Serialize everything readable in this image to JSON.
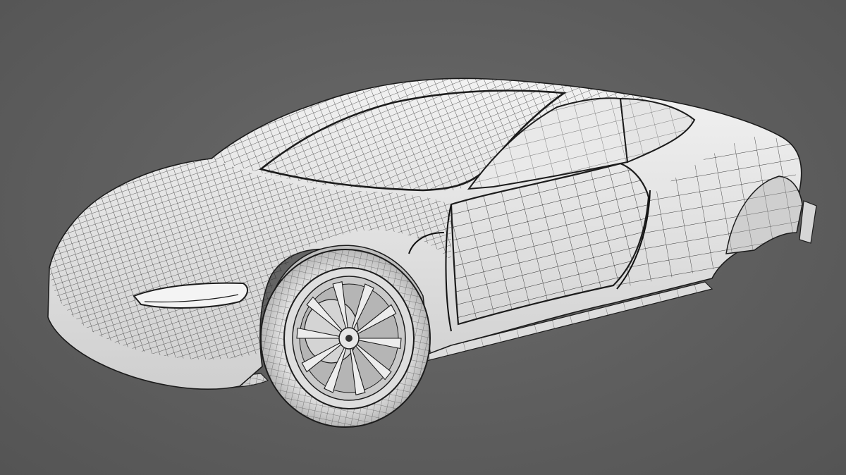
{
  "scene": {
    "subject": "car-wireframe-render",
    "colors": {
      "background": "#5f5f5f",
      "body_surface": "#e8e8e8",
      "body_shadow": "#bdbdbd",
      "wire": "#1c1c1c",
      "wheel_metal": "#d9d9d9",
      "tire": "#cfcfcf"
    }
  }
}
